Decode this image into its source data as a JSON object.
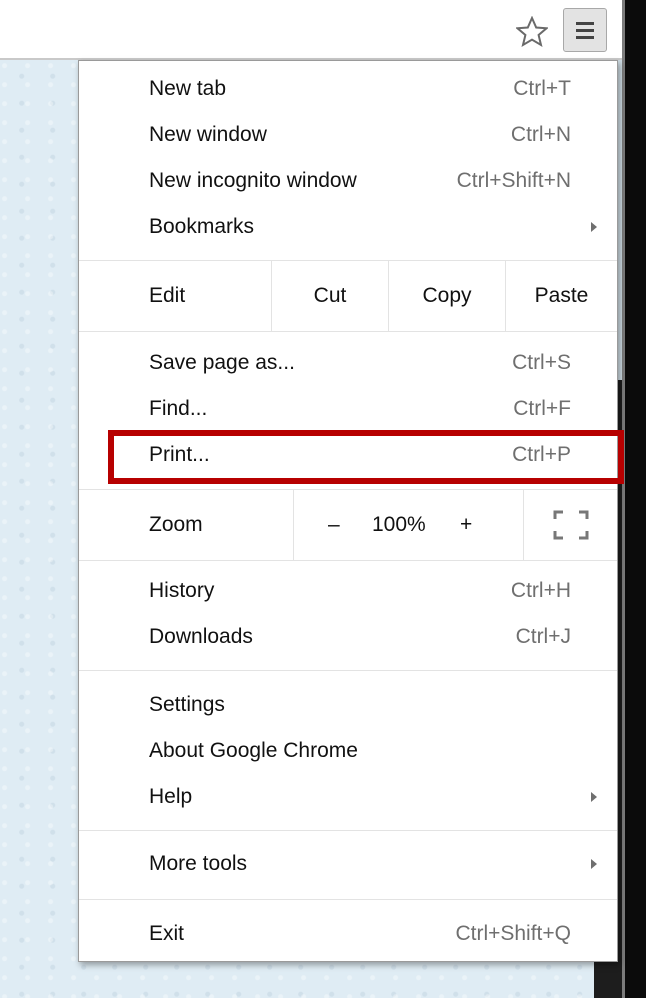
{
  "toolbar": {
    "star_icon": "star-outline-icon",
    "menu_icon": "hamburger-menu-icon"
  },
  "menu": {
    "group1": [
      {
        "label": "New tab",
        "shortcut": "Ctrl+T"
      },
      {
        "label": "New window",
        "shortcut": "Ctrl+N"
      },
      {
        "label": "New incognito window",
        "shortcut": "Ctrl+Shift+N"
      },
      {
        "label": "Bookmarks",
        "shortcut": ""
      }
    ],
    "edit": {
      "label": "Edit",
      "cut": "Cut",
      "copy": "Copy",
      "paste": "Paste"
    },
    "group2": [
      {
        "label": "Save page as...",
        "shortcut": "Ctrl+S"
      },
      {
        "label": "Find...",
        "shortcut": "Ctrl+F"
      },
      {
        "label": "Print...",
        "shortcut": "Ctrl+P"
      }
    ],
    "zoom": {
      "label": "Zoom",
      "minus": "–",
      "value": "100%",
      "plus": "+",
      "fullscreen_icon": "fullscreen-icon"
    },
    "group3": [
      {
        "label": "History",
        "shortcut": "Ctrl+H"
      },
      {
        "label": "Downloads",
        "shortcut": "Ctrl+J"
      }
    ],
    "group4": [
      {
        "label": "Settings",
        "shortcut": ""
      },
      {
        "label": "About Google Chrome",
        "shortcut": ""
      },
      {
        "label": "Help",
        "shortcut": ""
      }
    ],
    "group5": [
      {
        "label": "More tools",
        "shortcut": ""
      }
    ],
    "group6": [
      {
        "label": "Exit",
        "shortcut": "Ctrl+Shift+Q"
      }
    ]
  },
  "colors": {
    "highlight_border": "#b70000",
    "shortcut_text": "#6f6f6f"
  }
}
